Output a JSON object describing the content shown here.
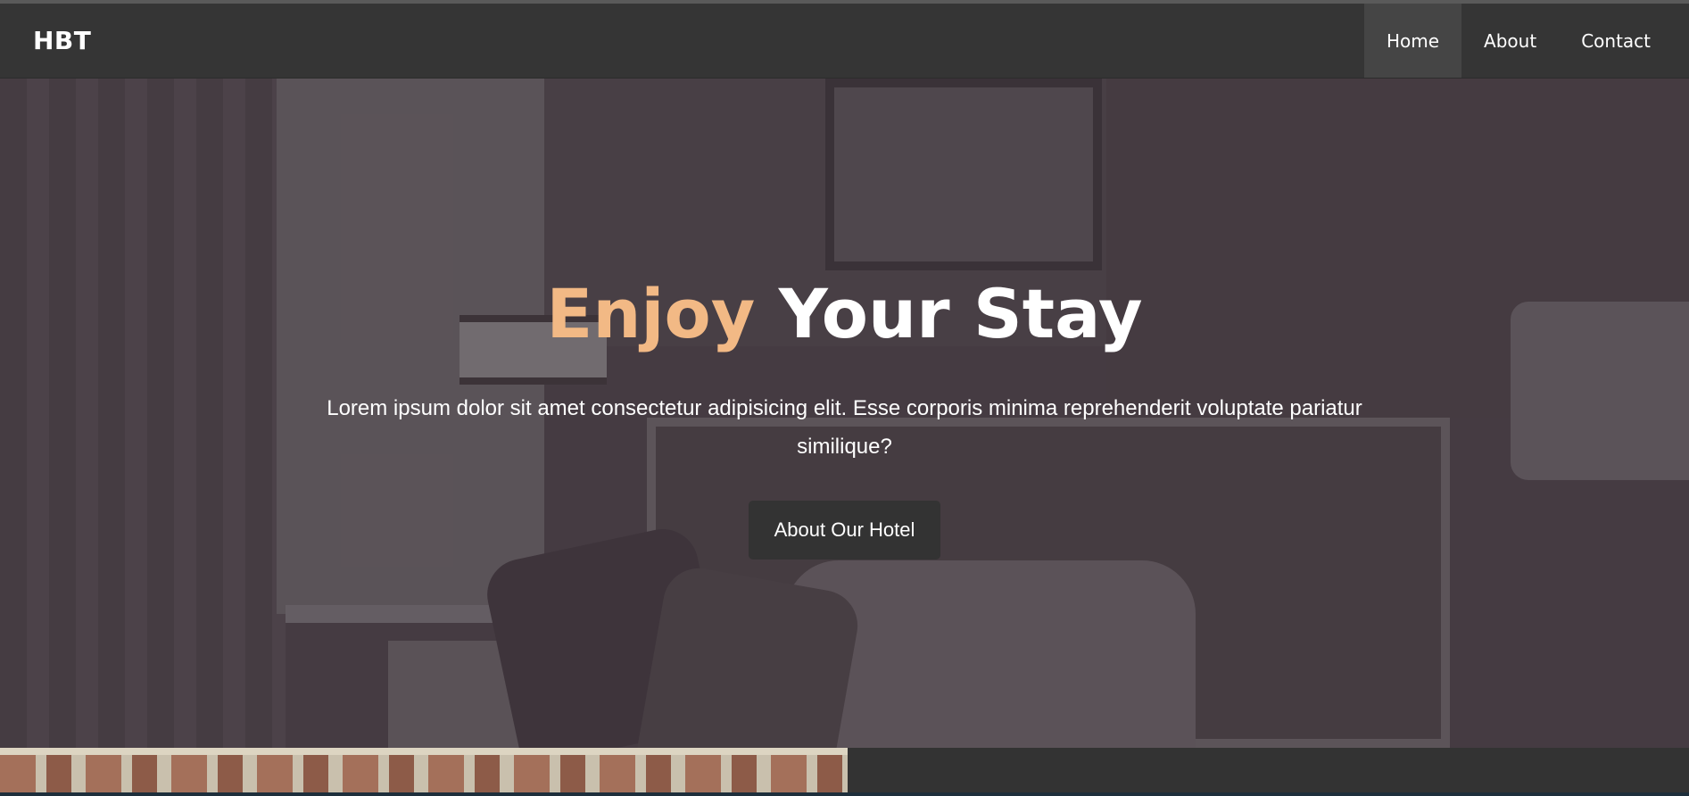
{
  "navbar": {
    "brand": "HBT",
    "links": [
      {
        "label": "Home",
        "active": true
      },
      {
        "label": "About",
        "active": false
      },
      {
        "label": "Contact",
        "active": false
      }
    ]
  },
  "hero": {
    "title_accent": "Enjoy",
    "title_rest": "Your Stay",
    "text": "Lorem ipsum dolor sit amet consectetur adipisicing elit. Esse corporis minima reprehenderit voluptate pariatur similique?",
    "button_label": "About Our Hotel"
  },
  "colors": {
    "navbar_bg": "#353535",
    "accent": "#f2b985",
    "button_bg": "#333333"
  }
}
